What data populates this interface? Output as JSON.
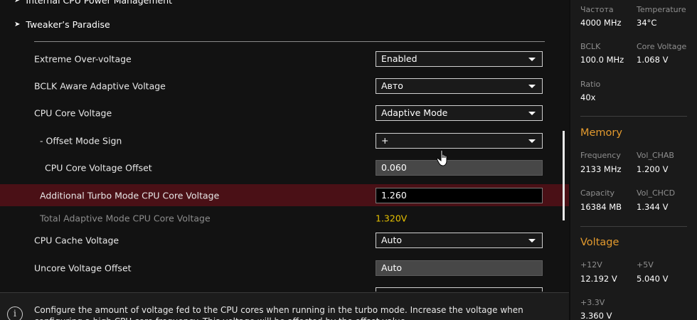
{
  "nav": {
    "item1": "Internal CPU Power Management",
    "item2": "Tweaker’s Paradise"
  },
  "settings": [
    {
      "label": "Extreme Over-voltage",
      "value": "Enabled"
    },
    {
      "label": "BCLK Aware Adaptive Voltage",
      "value": "Авто"
    },
    {
      "label": "CPU Core Voltage",
      "value": "Adaptive Mode"
    },
    {
      "label": "- Offset Mode Sign",
      "value": "+"
    },
    {
      "label": "CPU Core Voltage Offset",
      "value": "0.060"
    },
    {
      "label": "Additional Turbo Mode CPU Core Voltage",
      "value": "1.260"
    },
    {
      "label": "Total Adaptive Mode CPU Core Voltage",
      "value": "1.320V"
    },
    {
      "label": "CPU Cache Voltage",
      "value": "Auto"
    },
    {
      "label": "Uncore Voltage Offset",
      "value": "Auto"
    }
  ],
  "help": {
    "text": "Configure the amount of voltage fed to the CPU cores when running in the turbo mode. Increase the voltage when configuring a high CPU core frequency. This voltage will be affected by the offset value."
  },
  "monitor": {
    "cpu": {
      "freq_label": "Частота",
      "freq_value": "4000 MHz",
      "temp_label": "Temperature",
      "temp_value": "34°C",
      "bclk_label": "BCLK",
      "bclk_value": "100.0 MHz",
      "cv_label": "Core Voltage",
      "cv_value": "1.068 V",
      "ratio_label": "Ratio",
      "ratio_value": "40x"
    },
    "memory": {
      "title": "Memory",
      "freq_label": "Frequency",
      "freq_value": "2133 MHz",
      "chab_label": "Vol_CHAB",
      "chab_value": "1.200 V",
      "cap_label": "Capacity",
      "cap_value": "16384 MB",
      "chcd_label": "Vol_CHCD",
      "chcd_value": "1.344 V"
    },
    "voltage": {
      "title": "Voltage",
      "v12_label": "+12V",
      "v12_value": "12.192 V",
      "v5_label": "+5V",
      "v5_value": "5.040 V",
      "v33_label": "+3.3V",
      "v33_value": "3.360 V"
    }
  },
  "colors": {
    "highlight_row": "#4a1016",
    "value_yellow": "#e6c100",
    "section_orange": "#e39a2e"
  }
}
